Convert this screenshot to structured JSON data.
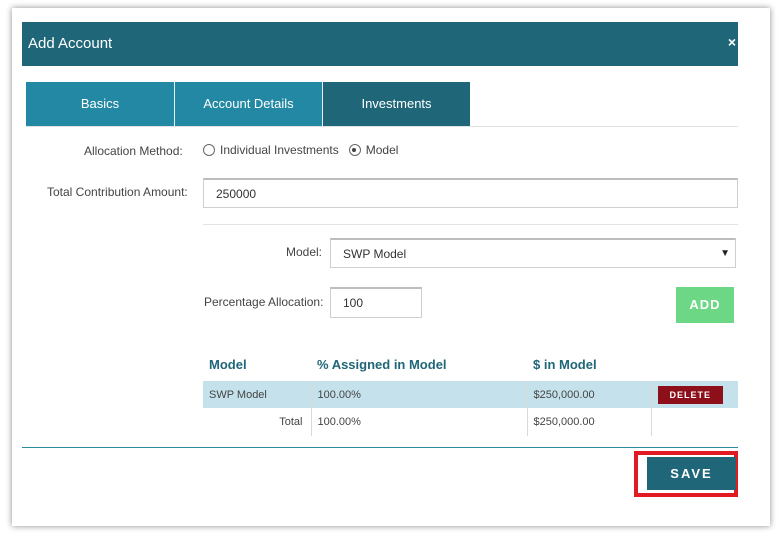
{
  "dialog": {
    "title": "Add Account",
    "close_glyph": "×"
  },
  "tabs": [
    {
      "label": "Basics"
    },
    {
      "label": "Account Details"
    },
    {
      "label": "Investments",
      "active": true
    }
  ],
  "form": {
    "allocation_method_label": "Allocation Method:",
    "allocation_options": [
      {
        "label": "Individual Investments",
        "checked": false
      },
      {
        "label": "Model",
        "checked": true
      }
    ],
    "total_contribution_label": "Total Contribution Amount:",
    "total_contribution_value": "250000",
    "model_label": "Model:",
    "model_value": "SWP Model",
    "percentage_label": "Percentage Allocation:",
    "percentage_value": "100",
    "add_label": "ADD"
  },
  "table": {
    "headers": [
      "Model",
      "% Assigned in Model",
      "$ in Model"
    ],
    "rows": [
      {
        "model": "SWP Model",
        "percent": "100.00%",
        "amount": "$250,000.00",
        "action": "DELETE"
      }
    ],
    "total": {
      "label": "Total",
      "percent": "100.00%",
      "amount": "$250,000.00"
    }
  },
  "footer": {
    "save_label": "SAVE"
  },
  "colors": {
    "header": "#1f6678",
    "tab": "#2388a4",
    "add_button": "#6cd886",
    "delete_button": "#8c0f1a",
    "highlight": "#e21b23",
    "row_highlight": "#c5e2ec"
  }
}
